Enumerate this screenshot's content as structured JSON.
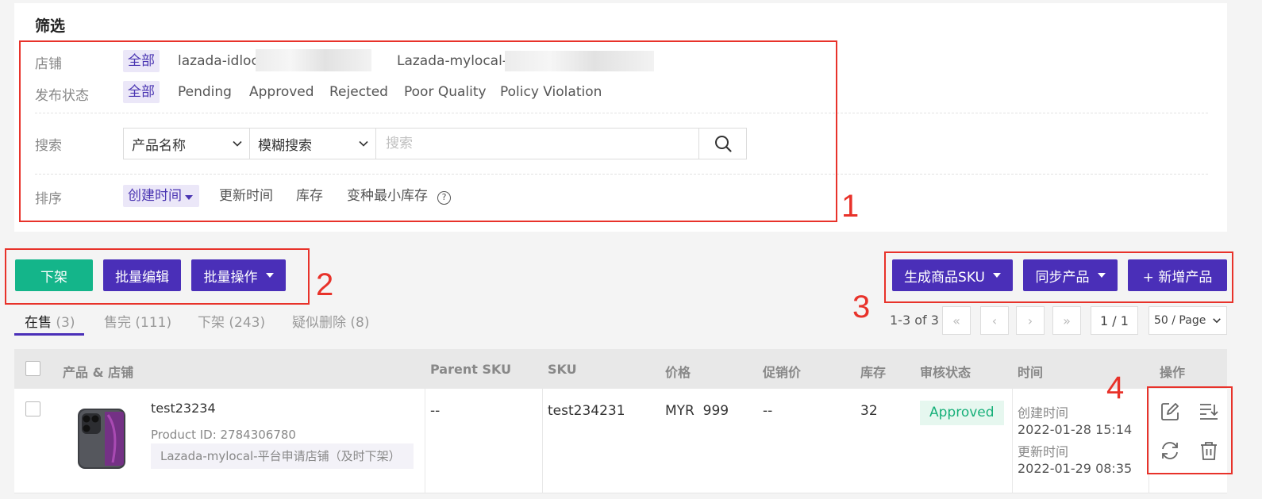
{
  "filter": {
    "title": "筛选",
    "store": {
      "label": "店铺",
      "all": "全部",
      "options": [
        "lazada-idloca",
        "Lazada-mylocal-平"
      ]
    },
    "status": {
      "label": "发布状态",
      "all": "全部",
      "options": [
        "Pending",
        "Approved",
        "Rejected",
        "Poor Quality",
        "Policy Violation"
      ]
    },
    "search": {
      "label": "搜索",
      "field_select": "产品名称",
      "mode_select": "模糊搜索",
      "placeholder": "搜索"
    },
    "sort": {
      "label": "排序",
      "options": [
        "创建时间",
        "更新时间",
        "库存",
        "变种最小库存"
      ],
      "help": "?"
    }
  },
  "annotations": [
    "1",
    "2",
    "3",
    "4"
  ],
  "actions_left": {
    "delist": "下架",
    "batch_edit": "批量编辑",
    "batch_ops": "批量操作"
  },
  "actions_right": {
    "gen_sku": "生成商品SKU",
    "sync": "同步产品",
    "add": "+ 新增产品"
  },
  "tabs": [
    {
      "label": "在售",
      "count": "(3)"
    },
    {
      "label": "售完",
      "count": "(111)"
    },
    {
      "label": "下架",
      "count": "(243)"
    },
    {
      "label": "疑似删除",
      "count": "(8)"
    }
  ],
  "pagination": {
    "range": "1-3 of 3",
    "page": "1 / 1",
    "per_page": "50 / Page"
  },
  "table": {
    "headers": [
      "产品 & 店铺",
      "Parent SKU",
      "SKU",
      "价格",
      "促销价",
      "库存",
      "审核状态",
      "时间",
      "操作"
    ],
    "rows": [
      {
        "name": "test23234",
        "product_id": "Product ID: 2784306780",
        "store": "Lazada-mylocal-平台申请店铺（及时下架）",
        "parent_sku": "--",
        "sku": "test234231",
        "price": "MYR  999",
        "promo": "--",
        "stock": "32",
        "status": "Approved",
        "created_label": "创建时间",
        "created": "2022-01-28 15:14",
        "updated_label": "更新时间",
        "updated": "2022-01-29 08:35"
      }
    ]
  },
  "colors": {
    "primary": "#4a2fb8",
    "success": "#14b58a",
    "annotation": "#e8322a"
  }
}
